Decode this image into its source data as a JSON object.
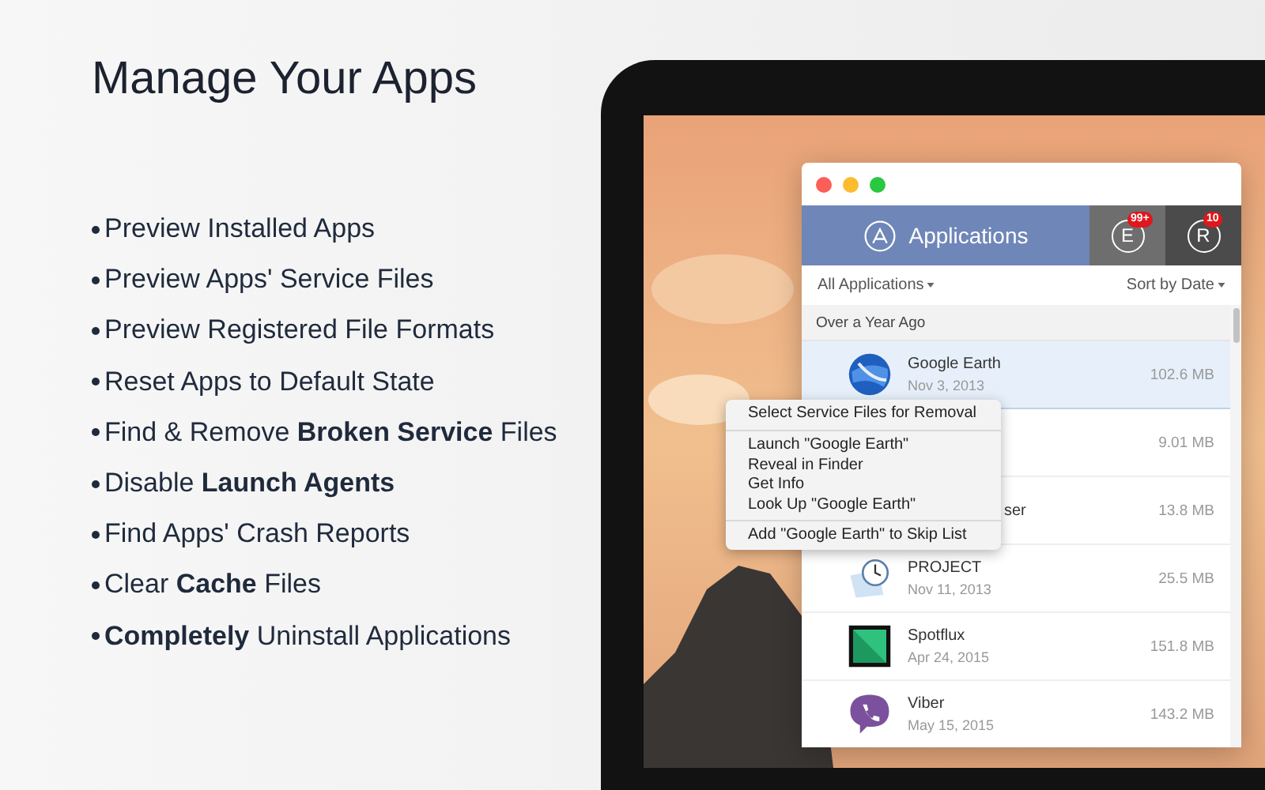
{
  "heading": "Manage Your Apps",
  "features": [
    "Preview Installed Apps",
    "Preview Apps' Service Files",
    "Preview Registered File Formats",
    "Reset Apps to Default State",
    "Find & Remove **Broken Service** Files",
    "Disable **Launch Agents**",
    "Find Apps' Crash Reports",
    "Clear **Cache** Files",
    "**Completely** Uninstall Applications"
  ],
  "app": {
    "tabs": [
      {
        "kind": "applications",
        "label": "Applications",
        "selected": true
      },
      {
        "kind": "extensions",
        "letter": "E",
        "badge": "99+",
        "selected": false
      },
      {
        "kind": "remnants",
        "letter": "R",
        "badge": "10",
        "selected": false
      }
    ],
    "filter": "All Applications",
    "sort": "Sort by Date",
    "section": "Over a Year Ago",
    "rows": [
      {
        "kind": "full",
        "name": "Google Earth",
        "date": "Nov 3, 2013",
        "size": "102.6 MB",
        "selected": true
      },
      {
        "kind": "covered",
        "size": "9.01 MB",
        "selected": false
      },
      {
        "kind": "covered",
        "name": "ser",
        "size": "13.8 MB",
        "selected": false
      },
      {
        "kind": "full",
        "name": "PROJECT",
        "date": "Nov 11, 2013",
        "size": "25.5 MB",
        "selected": false
      },
      {
        "kind": "full",
        "name": "Spotflux",
        "date": "Apr 24, 2015",
        "size": "151.8 MB",
        "selected": false
      },
      {
        "kind": "full",
        "name": "Viber",
        "date": "May 15, 2015",
        "size": "143.2 MB",
        "selected": false
      }
    ],
    "context_menu": [
      [
        "Select Service Files for Removal"
      ],
      [
        "Launch \"Google Earth\"",
        "Reveal in Finder",
        "Get Info",
        "Look Up \"Google Earth\""
      ],
      [
        "Add \"Google Earth\" to Skip List"
      ]
    ]
  }
}
